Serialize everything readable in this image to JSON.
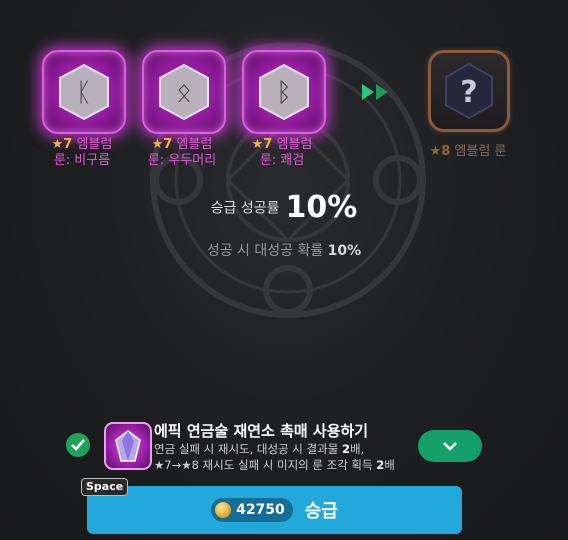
{
  "runes": [
    {
      "stars": "7",
      "grade": "엠블럼",
      "name": "룬: 비구름",
      "glyph": "ᛕ"
    },
    {
      "stars": "7",
      "grade": "엠블럼",
      "name": "룬: 우두머리",
      "glyph": "ᛟ"
    },
    {
      "stars": "7",
      "grade": "엠블럼",
      "name": "룬: 쾌검",
      "glyph": "ᛒ"
    }
  ],
  "result": {
    "stars": "8",
    "label": "엠블럼 룬",
    "glyph": "?"
  },
  "success_rate": {
    "label": "승급 성공률",
    "value": "10%"
  },
  "great_success": {
    "label": "성공 시 대성공 확률",
    "value": "10%"
  },
  "option": {
    "title": "에픽 연금술 재연소 촉매 사용하기",
    "desc_line1_a": "연금 실패 시 재시도, 대성공 시 결과물 ",
    "desc_line1_b": "2",
    "desc_line1_c": "배,",
    "desc_line2_a": "★7→★8 재시도 실패 시 미지의 룬 조각 획득 ",
    "desc_line2_b": "2",
    "desc_line2_c": "배",
    "checked": true
  },
  "hotkey": "Space",
  "upgrade": {
    "cost": "42750",
    "label": "승급"
  },
  "colors": {
    "accent": "#23a8dc",
    "green": "#13a06a",
    "magenta": "#c22fc3",
    "star": "#f7b733"
  }
}
